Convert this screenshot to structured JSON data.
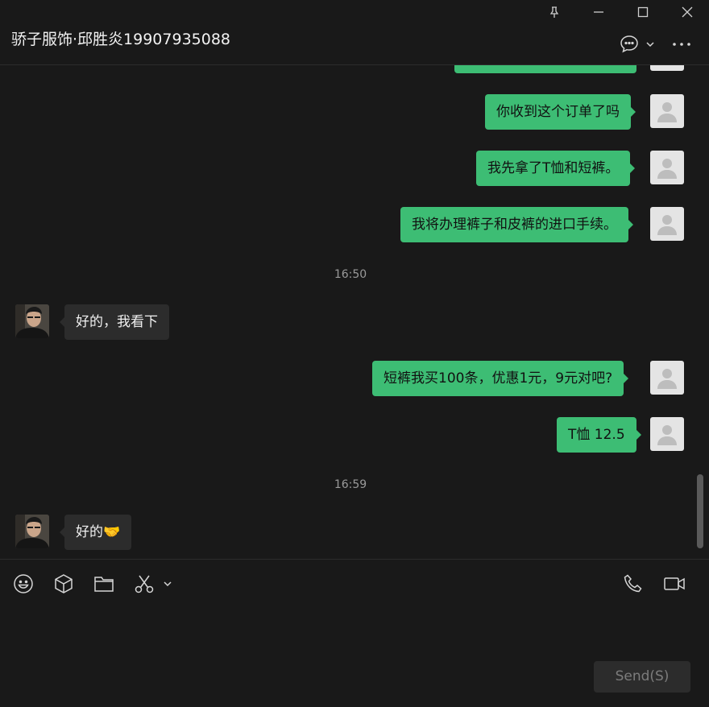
{
  "chat": {
    "title": "骄子服饰·邱胜炎19907935088"
  },
  "window_controls": [
    "pin-icon",
    "minimize-icon",
    "maximize-icon",
    "close-icon"
  ],
  "header_actions": [
    "chat-bubble-icon",
    "chevron-down-icon",
    "more-icon"
  ],
  "messages": [
    {
      "sender": "me",
      "text": ""
    },
    {
      "sender": "me",
      "text": "你收到这个订单了吗"
    },
    {
      "sender": "me",
      "text": "我先拿了T恤和短裤。"
    },
    {
      "sender": "me",
      "text": "我将办理裤子和皮裤的进口手续。"
    },
    {
      "timestamp": "16:50"
    },
    {
      "sender": "them",
      "text": "好的，我看下"
    },
    {
      "sender": "me",
      "text": "短裤我买100条，优惠1元，9元对吧?"
    },
    {
      "sender": "me",
      "text": "T恤 12.5"
    },
    {
      "timestamp": "16:59"
    },
    {
      "sender": "them",
      "text": "好的🤝"
    }
  ],
  "toolbar": [
    "emoji-icon",
    "sticker-box-icon",
    "folder-icon",
    "scissors-icon",
    "chevron-down-icon",
    "phone-icon",
    "video-icon"
  ],
  "composer": {
    "send_label": "Send(S)"
  },
  "colors": {
    "background": "#191919",
    "my_bubble": "#3dbd74",
    "their_bubble": "#2c2c2c",
    "send_button": "#2c2c2c"
  }
}
